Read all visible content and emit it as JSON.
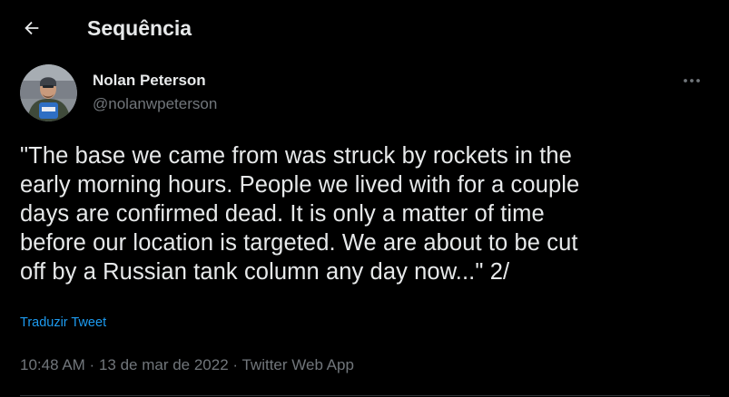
{
  "header": {
    "title": "Sequência"
  },
  "tweet": {
    "author_name": "Nolan Peterson",
    "author_handle": "@nolanwpeterson",
    "text": "\"The base we came from was struck by rockets in the\nearly morning hours. People we lived with for a couple\ndays are confirmed dead. It is only a matter of time\nbefore our location is targeted. We are about to be cut\noff by a Russian tank column any day now...\" 2/",
    "translate_label": "Traduzir Tweet",
    "time": "10:48 AM",
    "separator": " · ",
    "date": "13 de mar de 2022",
    "source": "Twitter Web App"
  },
  "icons": {
    "back": "arrow-left-icon",
    "more": "more-horizontal-icon",
    "avatar": "avatar-photo"
  },
  "colors": {
    "background": "#000000",
    "primary_text": "#e7e9ea",
    "secondary_text": "#71767b",
    "accent": "#1d9bf0",
    "divider": "#2f3336"
  }
}
